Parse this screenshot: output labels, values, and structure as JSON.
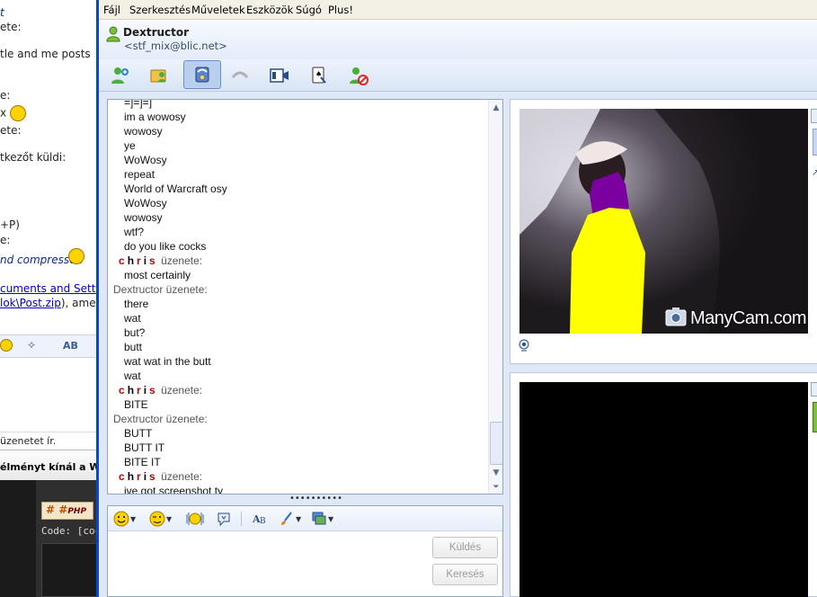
{
  "background_window": {
    "lines": [
      {
        "text": "t",
        "style": "ital"
      },
      {
        "text": "ete:",
        "style": "plain"
      },
      {
        "text": "tle and me posts",
        "style": "plain"
      },
      {
        "text": "e:",
        "style": "plain"
      },
      {
        "text": "ete:",
        "style": "plain"
      },
      {
        "text": "tkezőt küldi:",
        "style": "plain"
      },
      {
        "text": "+P)",
        "style": "plain"
      },
      {
        "text": "e:",
        "style": "plain"
      },
      {
        "text": "nd compressed",
        "style": "ital"
      },
      {
        "text": "cuments and Setti",
        "style": "link"
      },
      {
        "text": "lok\\Post.zip",
        "style": "link"
      },
      {
        "text": "), ame",
        "style": "plain"
      }
    ],
    "status": "üzenetet ír.",
    "taskbar_title": "élményt kínál a Wi",
    "php_label": "PHP",
    "code_label": "Code: [coc"
  },
  "menu": [
    "Fájl",
    "Szerkesztés",
    "Műveletek",
    "Eszközök",
    "Súgó",
    "Plus!"
  ],
  "contact": {
    "name": "Dextructor",
    "email": "<stf_mix@blic.net>"
  },
  "toolbar": {
    "icons": [
      "invite-contact-icon",
      "share-files-icon",
      "voice-call-icon",
      "hangup-icon",
      "video-icon",
      "games-icon",
      "block-contact-icon"
    ]
  },
  "chat": {
    "lines": [
      {
        "kind": "msg",
        "text": "=]=]=]"
      },
      {
        "kind": "msg",
        "text": "im a wowosy"
      },
      {
        "kind": "msg",
        "text": "wowosy"
      },
      {
        "kind": "msg",
        "text": "ye"
      },
      {
        "kind": "msg",
        "text": "WoWosy"
      },
      {
        "kind": "msg",
        "text": "repeat"
      },
      {
        "kind": "msg",
        "text": "World of Warcraft osy"
      },
      {
        "kind": "msg",
        "text": "WoWosy"
      },
      {
        "kind": "msg",
        "text": "wowosy"
      },
      {
        "kind": "msg",
        "text": "wtf?"
      },
      {
        "kind": "msg",
        "text": "do you like cocks"
      },
      {
        "kind": "chris",
        "name": "chris",
        "suffix": "üzenete:"
      },
      {
        "kind": "msg",
        "text": "most certainly"
      },
      {
        "kind": "hdr",
        "text": "Dextructor üzenete:"
      },
      {
        "kind": "msg",
        "text": "there"
      },
      {
        "kind": "msg",
        "text": "wat"
      },
      {
        "kind": "msg",
        "text": "but?"
      },
      {
        "kind": "msg",
        "text": "butt"
      },
      {
        "kind": "msg",
        "text": "wat wat in the butt"
      },
      {
        "kind": "msg",
        "text": "wat"
      },
      {
        "kind": "chris",
        "name": "chris",
        "suffix": "üzenete:"
      },
      {
        "kind": "msg",
        "text": "BITE"
      },
      {
        "kind": "hdr",
        "text": "Dextructor üzenete:"
      },
      {
        "kind": "msg",
        "text": "BUTT"
      },
      {
        "kind": "msg",
        "text": "BUTT IT"
      },
      {
        "kind": "msg",
        "text": "BITE IT"
      },
      {
        "kind": "chris",
        "name": "chris",
        "suffix": "üzenete:"
      },
      {
        "kind": "msg",
        "text": "ive got screenshot ty"
      }
    ]
  },
  "splitter_label": "••••••••••",
  "input": {
    "value": "",
    "send_label": "Küldés",
    "search_label": "Keresés"
  },
  "video": {
    "watermark": "ManyCam.com"
  },
  "colors": {
    "window_border": "#0a46d4",
    "chris_red": "#c00000",
    "paint_yellow": "#ffff00",
    "paint_purple": "#7b00a0"
  }
}
